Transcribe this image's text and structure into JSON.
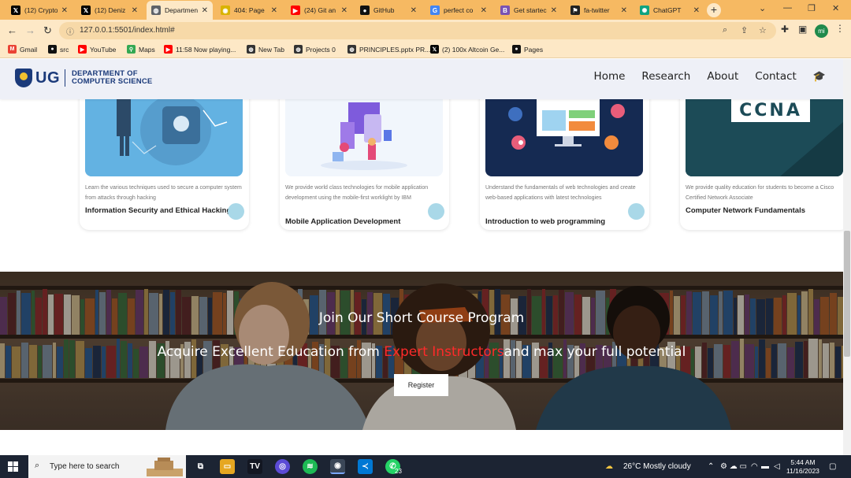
{
  "browser": {
    "tabs": [
      {
        "label": "(12) Crypto",
        "icon": "x-icon",
        "color": "#000000"
      },
      {
        "label": "(12) Deniz",
        "icon": "x-icon",
        "color": "#000000"
      },
      {
        "label": "Departmen",
        "icon": "globe-icon",
        "color": "#5f6368",
        "active": true
      },
      {
        "label": "404: Page",
        "icon": "coin-icon",
        "color": "#d9b300"
      },
      {
        "label": "(24) Git an",
        "icon": "youtube-icon",
        "color": "#ff0000"
      },
      {
        "label": "GitHub",
        "icon": "github-icon",
        "color": "#111111"
      },
      {
        "label": "perfect co",
        "icon": "google-icon",
        "color": "#4285f4"
      },
      {
        "label": "Get startec",
        "icon": "bootstrap-icon",
        "color": "#7952b3"
      },
      {
        "label": "fa-twitter",
        "icon": "flag-icon",
        "color": "#222222"
      },
      {
        "label": "ChatGPT",
        "icon": "chatgpt-icon",
        "color": "#10a37f"
      }
    ],
    "new_tab": "+",
    "url": "127.0.0.1:5501/index.html#",
    "profile_initials": "mi",
    "bookmarks": [
      {
        "label": "Gmail",
        "icon": "gmail-icon",
        "color": "#ea4335"
      },
      {
        "label": "src",
        "icon": "github-icon",
        "color": "#111111"
      },
      {
        "label": "YouTube",
        "icon": "youtube-icon",
        "color": "#ff0000"
      },
      {
        "label": "Maps",
        "icon": "maps-icon",
        "color": "#34a853"
      },
      {
        "label": "11:58 Now playing...",
        "icon": "youtube-icon",
        "color": "#ff0000"
      },
      {
        "label": "New Tab",
        "icon": "globe-icon",
        "color": "#333333"
      },
      {
        "label": "Projects 0",
        "icon": "globe-icon",
        "color": "#333333"
      },
      {
        "label": "PRINCIPLES.pptx PR...",
        "icon": "globe-icon",
        "color": "#333333"
      },
      {
        "label": "(2) 100x Altcoin Ge...",
        "icon": "x-icon",
        "color": "#000000"
      },
      {
        "label": "Pages",
        "icon": "github-icon",
        "color": "#111111"
      }
    ]
  },
  "site": {
    "logo_ug": "UG",
    "logo_line1": "DEPARTMENT OF",
    "logo_line2": "COMPUTER SCIENCE",
    "nav": [
      "Home",
      "Research",
      "About",
      "Contact"
    ],
    "courses": [
      {
        "desc": "Learn the various techniques used to secure a computer system from attacks through hacking",
        "title": "Information Security and Ethical Hacking"
      },
      {
        "desc": "We provide world class technologies for mobile application development using the mobile-first worklight by IBM",
        "title": "Mobile Application Development"
      },
      {
        "desc": "Understand the fundamentals of web technologies and create web-based applications with latest technologies",
        "title": "Introduction to web programming"
      },
      {
        "desc": "We provide quality education for students to become a Cisco Certified Network Associate",
        "title": "Computer Network Fundamentals",
        "image_text": "CCNA"
      }
    ],
    "hero": {
      "heading": "Join Our Short Course Program",
      "sub_before": "Acquire Excellent Education from ",
      "sub_highlight": "Expert Instructors",
      "sub_after": "and max your full potential",
      "button": "Register"
    }
  },
  "taskbar": {
    "search_placeholder": "Type here to search",
    "weather": "26°C  Mostly cloudy",
    "time": "5:44 AM",
    "date": "11/16/2023",
    "whatsapp_badge": "23"
  }
}
